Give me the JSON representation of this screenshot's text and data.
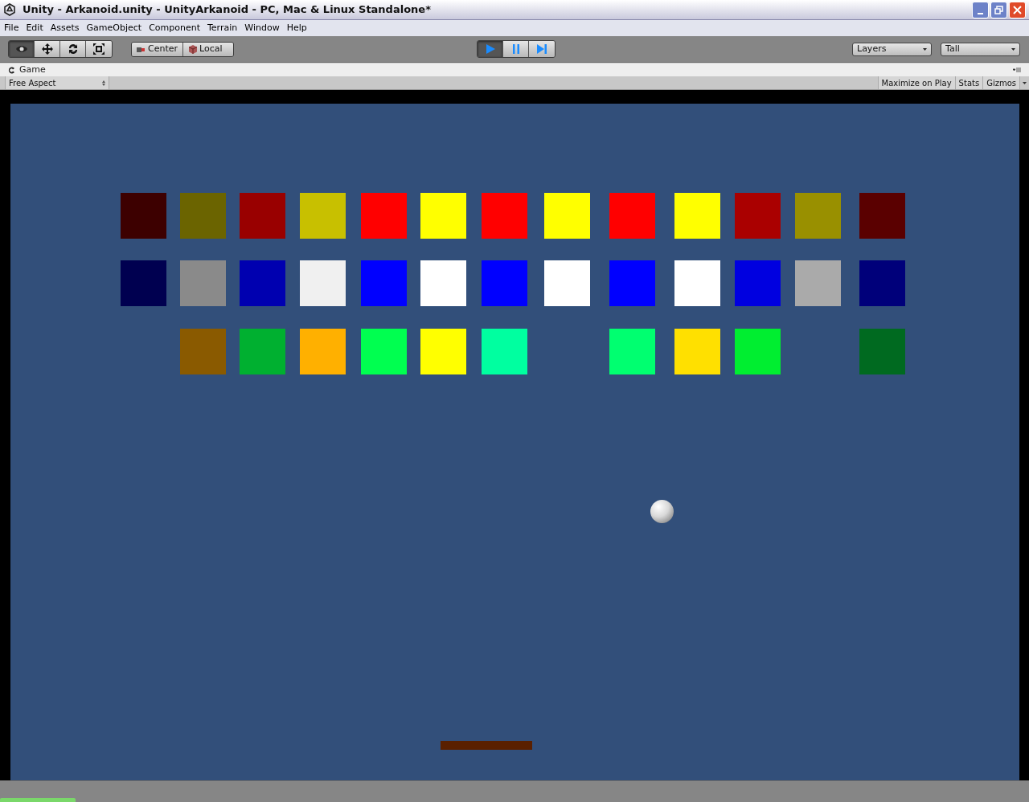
{
  "window": {
    "title": "Unity - Arkanoid.unity - UnityArkanoid - PC, Mac & Linux Standalone*"
  },
  "menu": [
    "File",
    "Edit",
    "Assets",
    "GameObject",
    "Component",
    "Terrain",
    "Window",
    "Help"
  ],
  "tools": [
    {
      "kind": "eye",
      "selected": true
    },
    {
      "kind": "move",
      "selected": false
    },
    {
      "kind": "rotate",
      "selected": false
    },
    {
      "kind": "scale",
      "selected": false
    }
  ],
  "pivot": [
    {
      "kind": "center",
      "label": "Center"
    },
    {
      "kind": "local",
      "label": "Local"
    }
  ],
  "playback": [
    {
      "kind": "play",
      "selected": true
    },
    {
      "kind": "pause",
      "selected": false
    },
    {
      "kind": "step",
      "selected": false
    }
  ],
  "dropdowns": [
    "Layers",
    "Tall"
  ],
  "game_tab": {
    "title": "Game",
    "aspect": "Free Aspect",
    "buttons": [
      "Maximize on Play",
      "Stats",
      "Gizmos"
    ]
  },
  "bricks": [
    {
      "cells": [
        {
          "color": "#3d0000"
        },
        {
          "color": "#6b6400"
        },
        {
          "color": "#990000"
        },
        {
          "color": "#c8c000"
        },
        {
          "color": "#ff0000"
        },
        {
          "color": "#ffff00"
        },
        {
          "color": "#ff0000"
        },
        {
          "color": "#ffff00"
        },
        {
          "color": "#ff0000"
        },
        {
          "color": "#ffff00"
        },
        {
          "color": "#aa0000"
        },
        {
          "color": "#999000"
        },
        {
          "color": "#5a0000"
        }
      ]
    },
    {
      "cells": [
        {
          "color": "#000050"
        },
        {
          "color": "#8a8a8a"
        },
        {
          "color": "#0000b0"
        },
        {
          "color": "#f0f0f0"
        },
        {
          "color": "#0000ff"
        },
        {
          "color": "#ffffff"
        },
        {
          "color": "#0000ff"
        },
        {
          "color": "#ffffff"
        },
        {
          "color": "#0000ff"
        },
        {
          "color": "#ffffff"
        },
        {
          "color": "#0000e0"
        },
        {
          "color": "#aaaaaa"
        },
        {
          "color": "#00007a"
        }
      ]
    },
    {
      "cells": [
        null,
        {
          "color": "#8a5a00"
        },
        {
          "color": "#00b030"
        },
        {
          "color": "#ffb000"
        },
        {
          "color": "#00ff50"
        },
        {
          "color": "#ffff00"
        },
        {
          "color": "#00ffa0"
        },
        null,
        {
          "color": "#00ff70"
        },
        {
          "color": "#ffe000"
        },
        {
          "color": "#00ee30"
        },
        null,
        {
          "color": "#006a20"
        }
      ]
    }
  ]
}
